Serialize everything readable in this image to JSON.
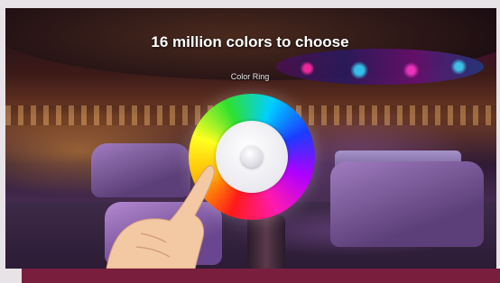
{
  "headline": "16 million colors to choose",
  "ring_label": "Color Ring",
  "colors": {
    "bottom_band": "#7a1e3e",
    "headline_text": "#ffffff"
  }
}
